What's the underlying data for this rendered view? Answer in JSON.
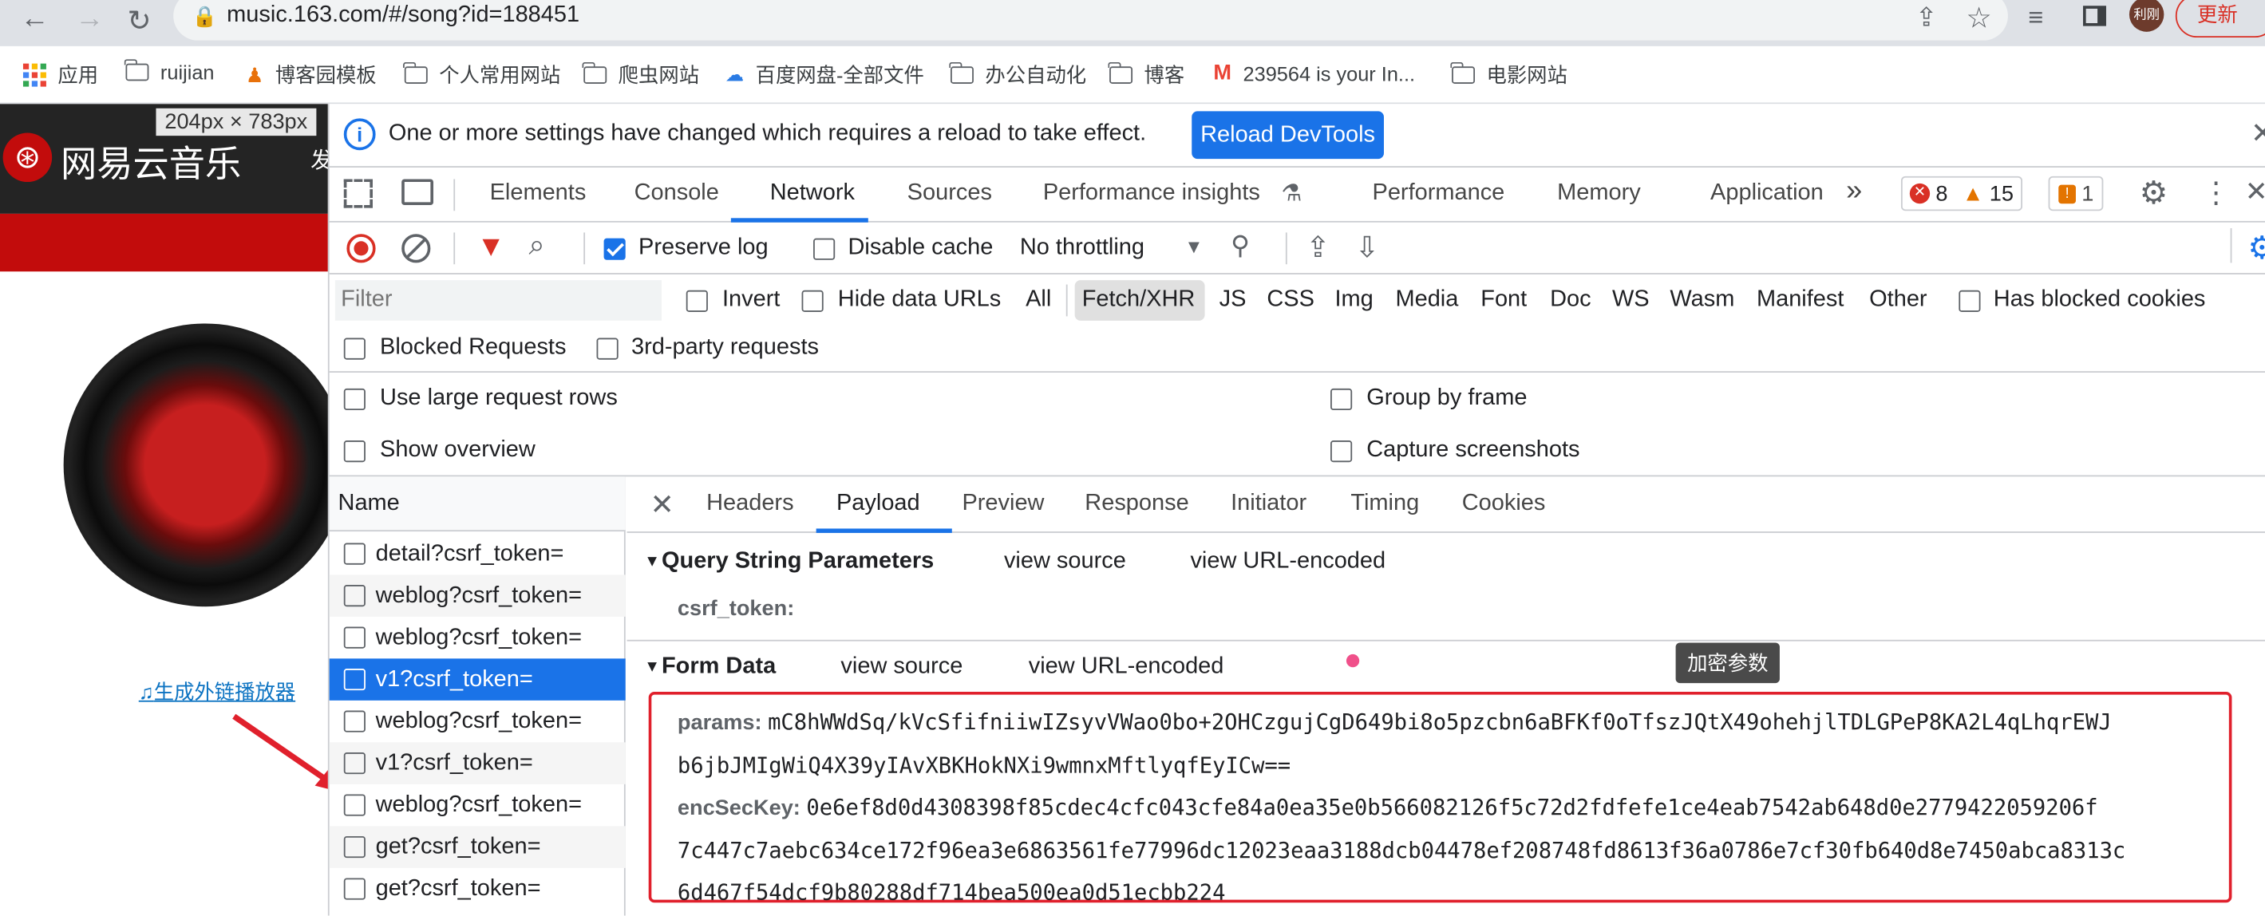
{
  "browser": {
    "url": "music.163.com/#/song?id=188451",
    "update_label": "更新",
    "profile_label": "利刚",
    "bookmarks": [
      "应用",
      "ruijian",
      "博客园模板",
      "个人常用网站",
      "爬虫网站",
      "百度网盘-全部文件",
      "办公自动化",
      "博客",
      "239564 is your In...",
      "电影网站"
    ]
  },
  "page": {
    "logo_text": "网易云音乐",
    "logo_extra": "发",
    "size_tooltip": "204px × 783px",
    "external_player_link": "生成外链播放器"
  },
  "devtools": {
    "info_message": "One or more settings have changed which requires a reload to take effect.",
    "reload_label": "Reload DevTools",
    "tabs": [
      "Elements",
      "Console",
      "Network",
      "Sources",
      "Performance insights",
      "Performance",
      "Memory",
      "Application"
    ],
    "active_tab": "Network",
    "more_tabs": "»",
    "errors": "8",
    "warnings": "15",
    "issues": "1",
    "toolbar": {
      "preserve_log": "Preserve log",
      "disable_cache": "Disable cache",
      "throttling": "No throttling"
    },
    "filter": {
      "placeholder": "Filter",
      "invert": "Invert",
      "hide_data_urls": "Hide data URLs",
      "types": [
        "All",
        "Fetch/XHR",
        "JS",
        "CSS",
        "Img",
        "Media",
        "Font",
        "Doc",
        "WS",
        "Wasm",
        "Manifest",
        "Other"
      ],
      "active_type": "Fetch/XHR",
      "has_blocked_cookies": "Has blocked cookies",
      "blocked_requests": "Blocked Requests",
      "third_party": "3rd-party requests"
    },
    "settings": {
      "large_rows": "Use large request rows",
      "group_by_frame": "Group by frame",
      "show_overview": "Show overview",
      "capture_screenshots": "Capture screenshots"
    },
    "requests": {
      "header": "Name",
      "items": [
        "detail?csrf_token=",
        "weblog?csrf_token=",
        "weblog?csrf_token=",
        "v1?csrf_token=",
        "weblog?csrf_token=",
        "v1?csrf_token=",
        "weblog?csrf_token=",
        "get?csrf_token=",
        "get?csrf_token="
      ],
      "selected_index": 3
    },
    "detail": {
      "tabs": [
        "Headers",
        "Payload",
        "Preview",
        "Response",
        "Initiator",
        "Timing",
        "Cookies"
      ],
      "active_tab": "Payload",
      "query_section": "Query String Parameters",
      "view_source": "view source",
      "view_url_encoded": "view URL-encoded",
      "csrf_key": "csrf_token:",
      "form_section": "Form Data",
      "tooltip": "加密参数",
      "params_key": "params:",
      "params_line1": "mC8hWWdSq/kVcSfifniiwIZsyvVWao0bo+2OHCzgujCgD649bi8o5pzcbn6aBFKf0oTfszJQtX49ohehjlTDLGPeP8KA2L4qLhqrEWJ",
      "params_line2": "b6jbJMIgWiQ4X39yIAvXBKHokNXi9wmnxMftlyqfEyICw==",
      "enc_key": "encSecKey:",
      "enc_line1": "0e6ef8d0d4308398f85cdec4cfc043cfe84a0ea35e0b566082126f5c72d2fdfefe1ce4eab7542ab648d0e2779422059206f",
      "enc_line2": "7c447c7aebc634ce172f96ea3e6863561fe77996dc12023eaa3188dcb04478ef208748fd8613f36a0786e7cf30fb640d8e7450abca8313c",
      "enc_line3": "6d467f54dcf9b80288df714bea500ea0d51ecbb224"
    }
  },
  "colors": {
    "accent": "#1a73e8",
    "netease_red": "#c20c0c",
    "highlight_box": "#e0202c"
  }
}
